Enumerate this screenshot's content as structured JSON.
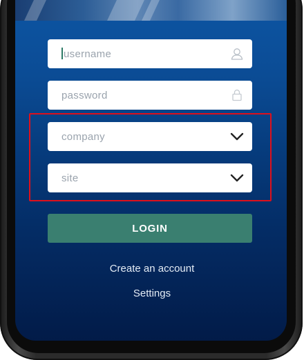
{
  "login_form": {
    "username_placeholder": "username",
    "password_placeholder": "password",
    "company_placeholder": "company",
    "site_placeholder": "site",
    "login_label": "LOGIN",
    "create_account_label": "Create an account",
    "settings_label": "Settings"
  },
  "icons": {
    "username": "user-icon",
    "password": "lock-icon",
    "company": "chevron-down-icon",
    "site": "chevron-down-icon"
  },
  "colors": {
    "login_button": "#3a7f70",
    "highlight_box": "#e0101b",
    "screen_top": "#0d55a3",
    "screen_bottom": "#021b48"
  }
}
